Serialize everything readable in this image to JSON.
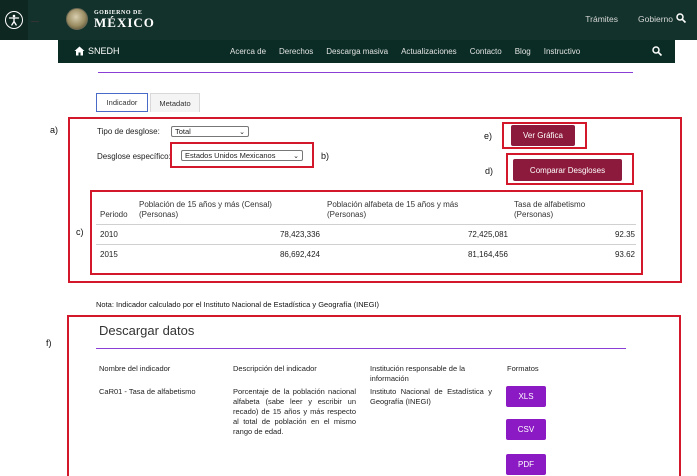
{
  "gov_header": {
    "brand_small": "GOBIERNO DE",
    "brand_big": "MÉXICO",
    "links": [
      "Trámites",
      "Gobierno"
    ]
  },
  "nav": {
    "brand": "SNEDH",
    "links": [
      "Acerca de",
      "Derechos",
      "Descarga masiva",
      "Actualizaciones",
      "Contacto",
      "Blog",
      "Instructivo"
    ]
  },
  "tabs": [
    "Indicador",
    "Metadato"
  ],
  "annotations": {
    "a": "a)",
    "b": "b)",
    "c": "c)",
    "d": "d)",
    "e": "e)",
    "f": "f)"
  },
  "form": {
    "tipo_label": "Tipo de desglose:",
    "tipo_value": "Total",
    "desglose_label": "Desglose específico:",
    "desglose_value": "Estados Unidos Mexicanos"
  },
  "buttons": {
    "ver_grafica": "Ver Gráfica",
    "comparar": "Comparar Desgloses"
  },
  "table": {
    "headers": [
      "Periodo",
      "Población de 15 años y más (Censal) (Personas)",
      "Población alfabeta de 15 años y más (Personas)",
      "Tasa de alfabetismo (Personas)"
    ],
    "rows": [
      [
        "2010",
        "78,423,336",
        "72,425,081",
        "92.35"
      ],
      [
        "2015",
        "86,692,424",
        "81,164,456",
        "93.62"
      ]
    ]
  },
  "note": "Nota: Indicador calculado por el Instituto Nacional de Estadística y Geografía (INEGI)",
  "download": {
    "title": "Descargar datos",
    "headers": [
      "Nombre del indicador",
      "Descripción del indicador",
      "Institución responsable de la información",
      "Formatos"
    ],
    "indicator_name": "CaR01 - Tasa de alfabetismo",
    "description": "Porcentaje de la población nacional alfabeta (sabe leer y escribir un recado) de 15 años y más respecto al total de población en el mismo rango de edad.",
    "institution": "Instituto Nacional de Estadística y Geografía (INEGI)",
    "formats": [
      "XLS",
      "CSV",
      "PDF"
    ]
  },
  "colors": {
    "gov_green": "#13322b",
    "nav_green": "#0a2c24",
    "maroon": "#8b1a3c",
    "purple": "#8c1ac4",
    "annotation_red": "#d3182c"
  }
}
